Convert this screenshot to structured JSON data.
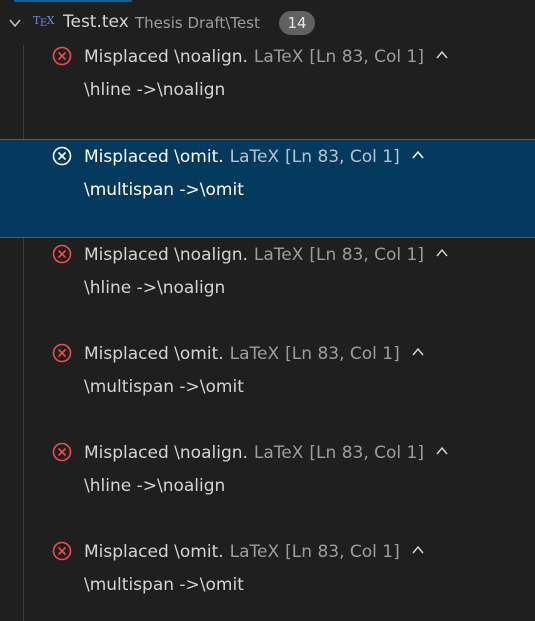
{
  "file": {
    "name": "Test.tex",
    "path": "Thesis Draft\\Test",
    "count": "14",
    "icon": "tex-file-icon"
  },
  "colors": {
    "background": "#1f1f1f",
    "selected_background": "#04395e",
    "error_red": "#f14c4c",
    "badge": "#616161"
  },
  "problems": [
    {
      "message": "Misplaced \\noalign.",
      "source": "LaTeX",
      "location": "[Ln 83, Col 1]",
      "detail": "\\hline ->\\noalign",
      "selected": false
    },
    {
      "message": "Misplaced \\omit.",
      "source": "LaTeX",
      "location": "[Ln 83, Col 1]",
      "detail": "\\multispan ->\\omit",
      "selected": true
    },
    {
      "message": "Misplaced \\noalign.",
      "source": "LaTeX",
      "location": "[Ln 83, Col 1]",
      "detail": "\\hline ->\\noalign",
      "selected": false
    },
    {
      "message": "Misplaced \\omit.",
      "source": "LaTeX",
      "location": "[Ln 83, Col 1]",
      "detail": "\\multispan ->\\omit",
      "selected": false
    },
    {
      "message": "Misplaced \\noalign.",
      "source": "LaTeX",
      "location": "[Ln 83, Col 1]",
      "detail": "\\hline ->\\noalign",
      "selected": false
    },
    {
      "message": "Misplaced \\omit.",
      "source": "LaTeX",
      "location": "[Ln 83, Col 1]",
      "detail": "\\multispan ->\\omit",
      "selected": false
    }
  ]
}
